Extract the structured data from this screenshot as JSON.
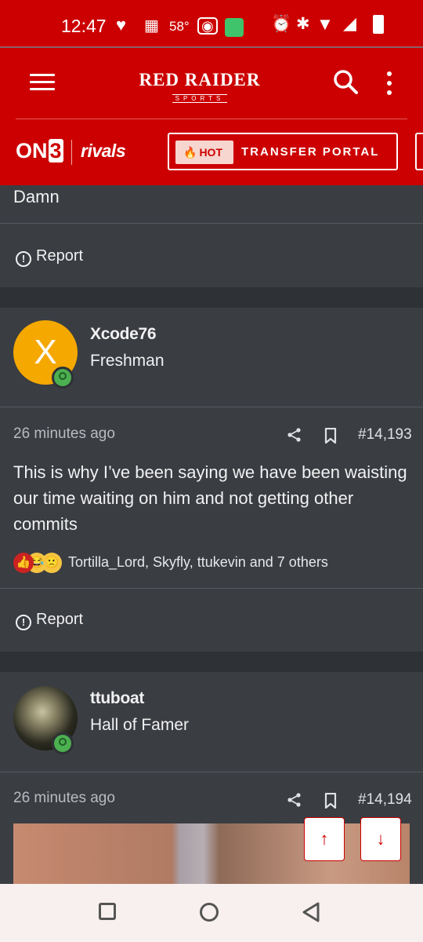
{
  "status_bar": {
    "time": "12:47",
    "temperature": "58°",
    "icons": [
      "heart-icon",
      "grid-icon",
      "hotspot-icon",
      "battery-saver-icon",
      "alarm-icon",
      "bluetooth-icon",
      "wifi-icon",
      "signal-icon",
      "battery-icon"
    ]
  },
  "header": {
    "logo_main": "RED RAIDER",
    "logo_sub": "SPORTS",
    "on3_label": "ON",
    "on3_number": "3",
    "rivals_label": "rivals",
    "hot_label": "HOT",
    "portal_label": "TRANSFER PORTAL",
    "accent_color": "#cc0000"
  },
  "posts": [
    {
      "text": "Damn",
      "report_label": "Report"
    },
    {
      "username": "Xcode76",
      "rank": "Freshman",
      "avatar_letter": "X",
      "time_ago": "26 minutes ago",
      "post_number": "#14,193",
      "text": "This is why I’ve been saying we have been waisting our time waiting on him and not getting other commits",
      "reactions_text": "Tortilla_Lord, Skyfly, ttukevin and 7 others",
      "report_label": "Report"
    },
    {
      "username": "ttuboat",
      "rank": "Hall of Famer",
      "time_ago": "26 minutes ago",
      "post_number": "#14,194"
    }
  ],
  "scroll_buttons": {
    "up": "↑",
    "down": "↓"
  }
}
